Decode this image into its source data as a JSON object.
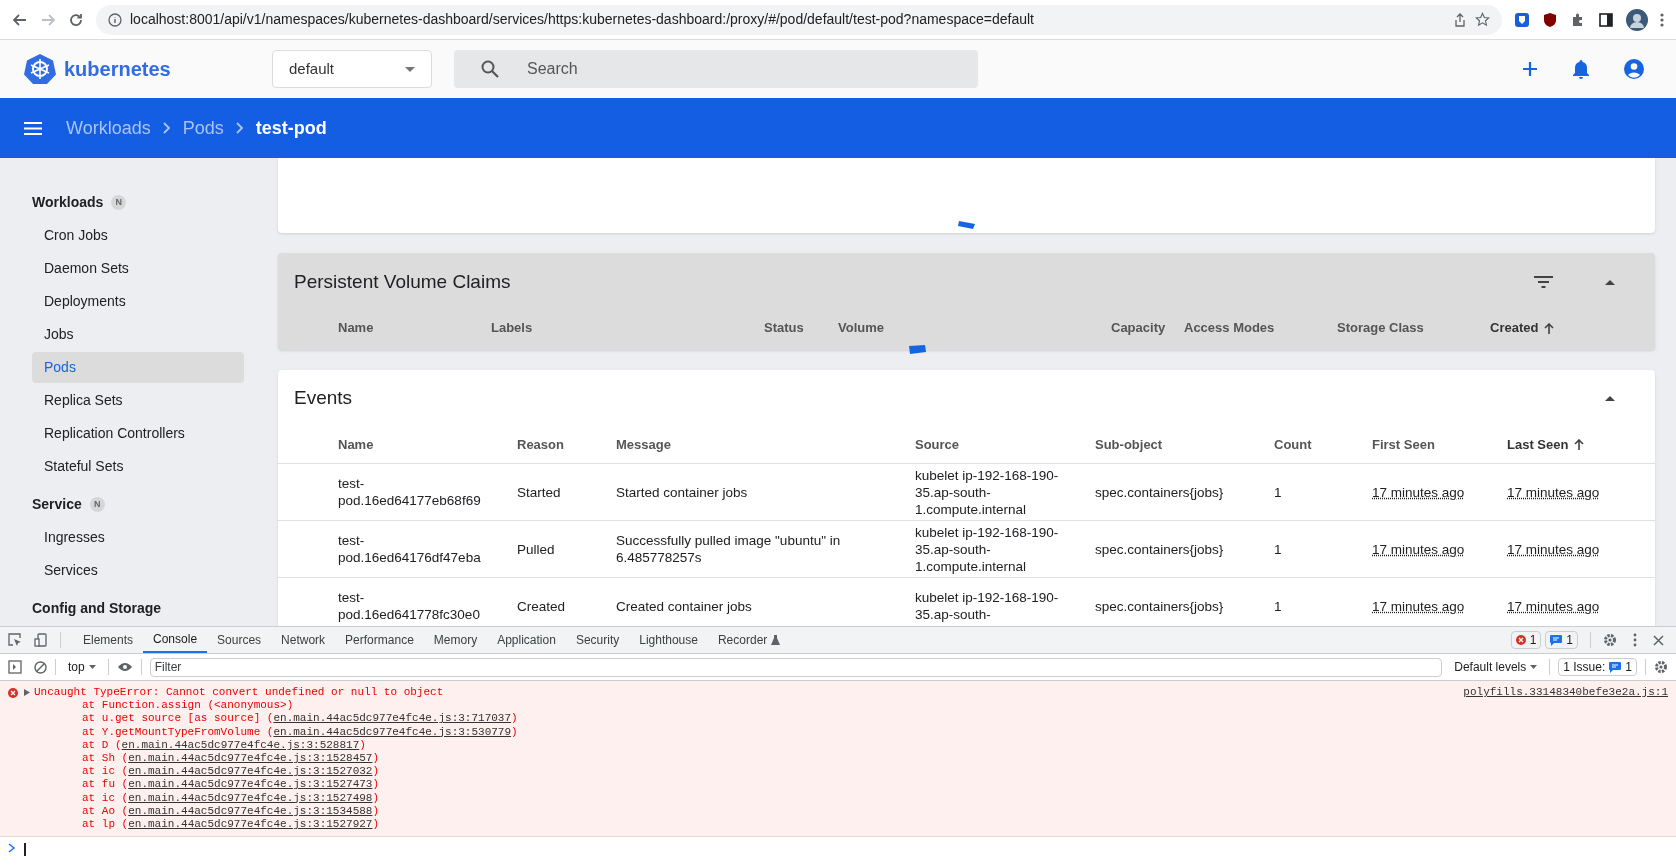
{
  "browser": {
    "url": "localhost:8001/api/v1/namespaces/kubernetes-dashboard/services/https:kubernetes-dashboard:/proxy/#/pod/default/test-pod?namespace=default"
  },
  "app": {
    "logo": "kubernetes",
    "namespace": "default",
    "search_placeholder": "Search"
  },
  "breadcrumbs": [
    {
      "label": "Workloads",
      "current": false
    },
    {
      "label": "Pods",
      "current": false
    },
    {
      "label": "test-pod",
      "current": true
    }
  ],
  "sidebar": [
    {
      "title": "Workloads",
      "badge": "N",
      "items": [
        {
          "label": "Cron Jobs",
          "selected": false
        },
        {
          "label": "Daemon Sets",
          "selected": false
        },
        {
          "label": "Deployments",
          "selected": false
        },
        {
          "label": "Jobs",
          "selected": false
        },
        {
          "label": "Pods",
          "selected": true
        },
        {
          "label": "Replica Sets",
          "selected": false
        },
        {
          "label": "Replication Controllers",
          "selected": false
        },
        {
          "label": "Stateful Sets",
          "selected": false
        }
      ]
    },
    {
      "title": "Service",
      "badge": "N",
      "items": [
        {
          "label": "Ingresses",
          "selected": false
        },
        {
          "label": "Services",
          "selected": false
        }
      ]
    },
    {
      "title": "Config and Storage"
    }
  ],
  "pvc": {
    "title": "Persistent Volume Claims",
    "columns": [
      {
        "label": "Name",
        "sorted": false
      },
      {
        "label": "Labels",
        "sorted": false
      },
      {
        "label": "Status",
        "sorted": false
      },
      {
        "label": "Volume",
        "sorted": false
      },
      {
        "label": "Capacity",
        "sorted": false
      },
      {
        "label": "Access Modes",
        "sorted": false
      },
      {
        "label": "Storage Class",
        "sorted": false
      },
      {
        "label": "Created",
        "sorted": true
      }
    ]
  },
  "events": {
    "title": "Events",
    "columns": [
      {
        "label": "Name",
        "sorted": false
      },
      {
        "label": "Reason",
        "sorted": false
      },
      {
        "label": "Message",
        "sorted": false
      },
      {
        "label": "Source",
        "sorted": false
      },
      {
        "label": "Sub-object",
        "sorted": false
      },
      {
        "label": "Count",
        "sorted": false
      },
      {
        "label": "First Seen",
        "sorted": false
      },
      {
        "label": "Last Seen",
        "sorted": true
      }
    ],
    "rows": [
      {
        "name": "test-pod.16ed64177eb68f69",
        "reason": "Started",
        "message": "Started container jobs",
        "source": "kubelet ip-192-168-190-35.ap-south-1.compute.internal",
        "subobject": "spec.containers{jobs}",
        "count": "1",
        "first_seen": "17 minutes ago",
        "last_seen": "17 minutes ago"
      },
      {
        "name": "test-pod.16ed64176df47eba",
        "reason": "Pulled",
        "message": "Successfully pulled image \"ubuntu\" in 6.485778257s",
        "source": "kubelet ip-192-168-190-35.ap-south-1.compute.internal",
        "subobject": "spec.containers{jobs}",
        "count": "1",
        "first_seen": "17 minutes ago",
        "last_seen": "17 minutes ago"
      },
      {
        "name": "test-pod.16ed641778fc30e0",
        "reason": "Created",
        "message": "Created container jobs",
        "source": "kubelet ip-192-168-190-35.ap-south-",
        "subobject": "spec.containers{jobs}",
        "count": "1",
        "first_seen": "17 minutes ago",
        "last_seen": "17 minutes ago"
      }
    ]
  },
  "devtools": {
    "tabs": [
      {
        "label": "Elements",
        "selected": false
      },
      {
        "label": "Console",
        "selected": true
      },
      {
        "label": "Sources",
        "selected": false
      },
      {
        "label": "Network",
        "selected": false
      },
      {
        "label": "Performance",
        "selected": false
      },
      {
        "label": "Memory",
        "selected": false
      },
      {
        "label": "Application",
        "selected": false
      },
      {
        "label": "Security",
        "selected": false
      },
      {
        "label": "Lighthouse",
        "selected": false
      },
      {
        "label": "Recorder",
        "selected": false
      }
    ],
    "error_count": "1",
    "message_count": "1",
    "context": "top",
    "filter_placeholder": "Filter",
    "levels": "Default levels",
    "issues_label": "1 Issue:",
    "issues_count": "1"
  },
  "console": {
    "error": "Uncaught TypeError: Cannot convert undefined or null to object",
    "source": "polyfills.33148340befe3e2a.js:1",
    "stack": [
      {
        "text": "at Function.assign (<anonymous>)"
      },
      {
        "text": "at u.get source [as source] (",
        "link": "en.main.44ac5dc977e4fc4e.js:3:717037",
        "tail": ")"
      },
      {
        "text": "at Y.getMountTypeFromVolume (",
        "link": "en.main.44ac5dc977e4fc4e.js:3:530779",
        "tail": ")"
      },
      {
        "text": "at D (",
        "link": "en.main.44ac5dc977e4fc4e.js:3:528817",
        "tail": ")"
      },
      {
        "text": "at Sh (",
        "link": "en.main.44ac5dc977e4fc4e.js:3:1528457",
        "tail": ")"
      },
      {
        "text": "at ic (",
        "link": "en.main.44ac5dc977e4fc4e.js:3:1527032",
        "tail": ")"
      },
      {
        "text": "at fu (",
        "link": "en.main.44ac5dc977e4fc4e.js:3:1527473",
        "tail": ")"
      },
      {
        "text": "at ic (",
        "link": "en.main.44ac5dc977e4fc4e.js:3:1527498",
        "tail": ")"
      },
      {
        "text": "at Ao (",
        "link": "en.main.44ac5dc977e4fc4e.js:3:1534588",
        "tail": ")"
      },
      {
        "text": "at lp (",
        "link": "en.main.44ac5dc977e4fc4e.js:3:1527927",
        "tail": ")"
      }
    ]
  }
}
